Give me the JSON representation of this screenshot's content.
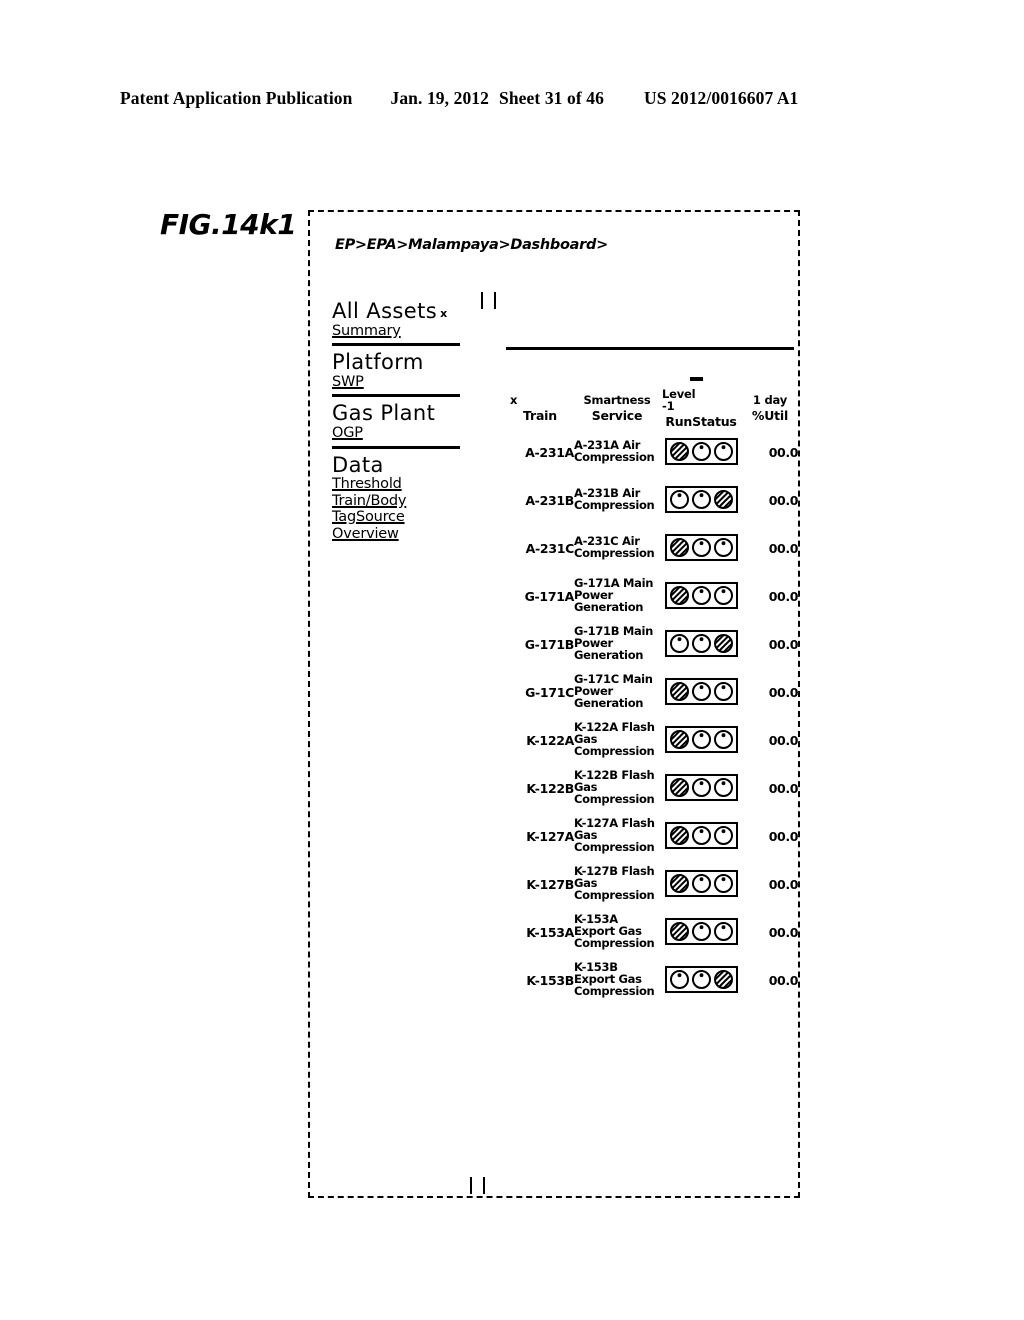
{
  "patent_header": {
    "publication": "Patent Application Publication",
    "date": "Jan. 19, 2012",
    "sheet": "Sheet 31 of 46",
    "number": "US 2012/0016607 A1"
  },
  "figure": {
    "label": "FIG.14k1"
  },
  "screen": {
    "breadcrumb": "EP>EPA>Malampaya>Dashboard>",
    "sidebar": {
      "groups": [
        {
          "title": "All Assets",
          "superscript": "x",
          "links": [
            "Summary"
          ]
        },
        {
          "title": "Platform",
          "superscript": "",
          "links": [
            "SWP"
          ]
        },
        {
          "title": "Gas Plant",
          "superscript": "",
          "links": [
            "OGP"
          ]
        },
        {
          "title": "Data",
          "superscript": "",
          "links": [
            "Threshold",
            "Train/Body",
            "TagSource",
            "Overview"
          ]
        }
      ]
    },
    "table": {
      "headers": {
        "train": {
          "over": "x",
          "sub": "Train"
        },
        "service": {
          "over": "Smartness",
          "sub": "Service"
        },
        "runstatus": {
          "over": "Level\n-1",
          "over_line1": "Level",
          "over_line2": "-1",
          "sub": "RunStatus"
        },
        "util": {
          "over": "1 day",
          "sub": "%Util"
        }
      },
      "rows": [
        {
          "train": "A-231A",
          "service": "A-231A Air Compression",
          "lights": [
            "hatched",
            "dot",
            "dot"
          ],
          "util": "00.0"
        },
        {
          "train": "A-231B",
          "service": "A-231B Air Compression",
          "lights": [
            "dot",
            "dot",
            "hatched"
          ],
          "util": "00.0"
        },
        {
          "train": "A-231C",
          "service": "A-231C Air Compression",
          "lights": [
            "hatched",
            "dot",
            "dot"
          ],
          "util": "00.0"
        },
        {
          "train": "G-171A",
          "service": "G-171A Main Power Generation",
          "lights": [
            "hatched",
            "dot",
            "dot"
          ],
          "util": "00.0"
        },
        {
          "train": "G-171B",
          "service": "G-171B Main Power Generation",
          "lights": [
            "dot",
            "dot",
            "hatched"
          ],
          "util": "00.0"
        },
        {
          "train": "G-171C",
          "service": "G-171C Main Power Generation",
          "lights": [
            "hatched",
            "dot",
            "dot"
          ],
          "util": "00.0"
        },
        {
          "train": "K-122A",
          "service": "K-122A Flash Gas Compression",
          "lights": [
            "hatched",
            "dot",
            "dot"
          ],
          "util": "00.0"
        },
        {
          "train": "K-122B",
          "service": "K-122B Flash Gas Compression",
          "lights": [
            "hatched",
            "dot",
            "dot"
          ],
          "util": "00.0"
        },
        {
          "train": "K-127A",
          "service": "K-127A Flash Gas Compression",
          "lights": [
            "hatched",
            "dot",
            "dot"
          ],
          "util": "00.0"
        },
        {
          "train": "K-127B",
          "service": "K-127B Flash Gas Compression",
          "lights": [
            "hatched",
            "dot",
            "dot"
          ],
          "util": "00.0"
        },
        {
          "train": "K-153A",
          "service": "K-153A Export Gas Compression",
          "lights": [
            "hatched",
            "dot",
            "dot"
          ],
          "util": "00.0"
        },
        {
          "train": "K-153B",
          "service": "K-153B Export Gas Compression",
          "lights": [
            "dot",
            "dot",
            "hatched"
          ],
          "util": "00.0"
        }
      ]
    }
  },
  "colors": {
    "ink": "#000000",
    "paper": "#ffffff"
  }
}
